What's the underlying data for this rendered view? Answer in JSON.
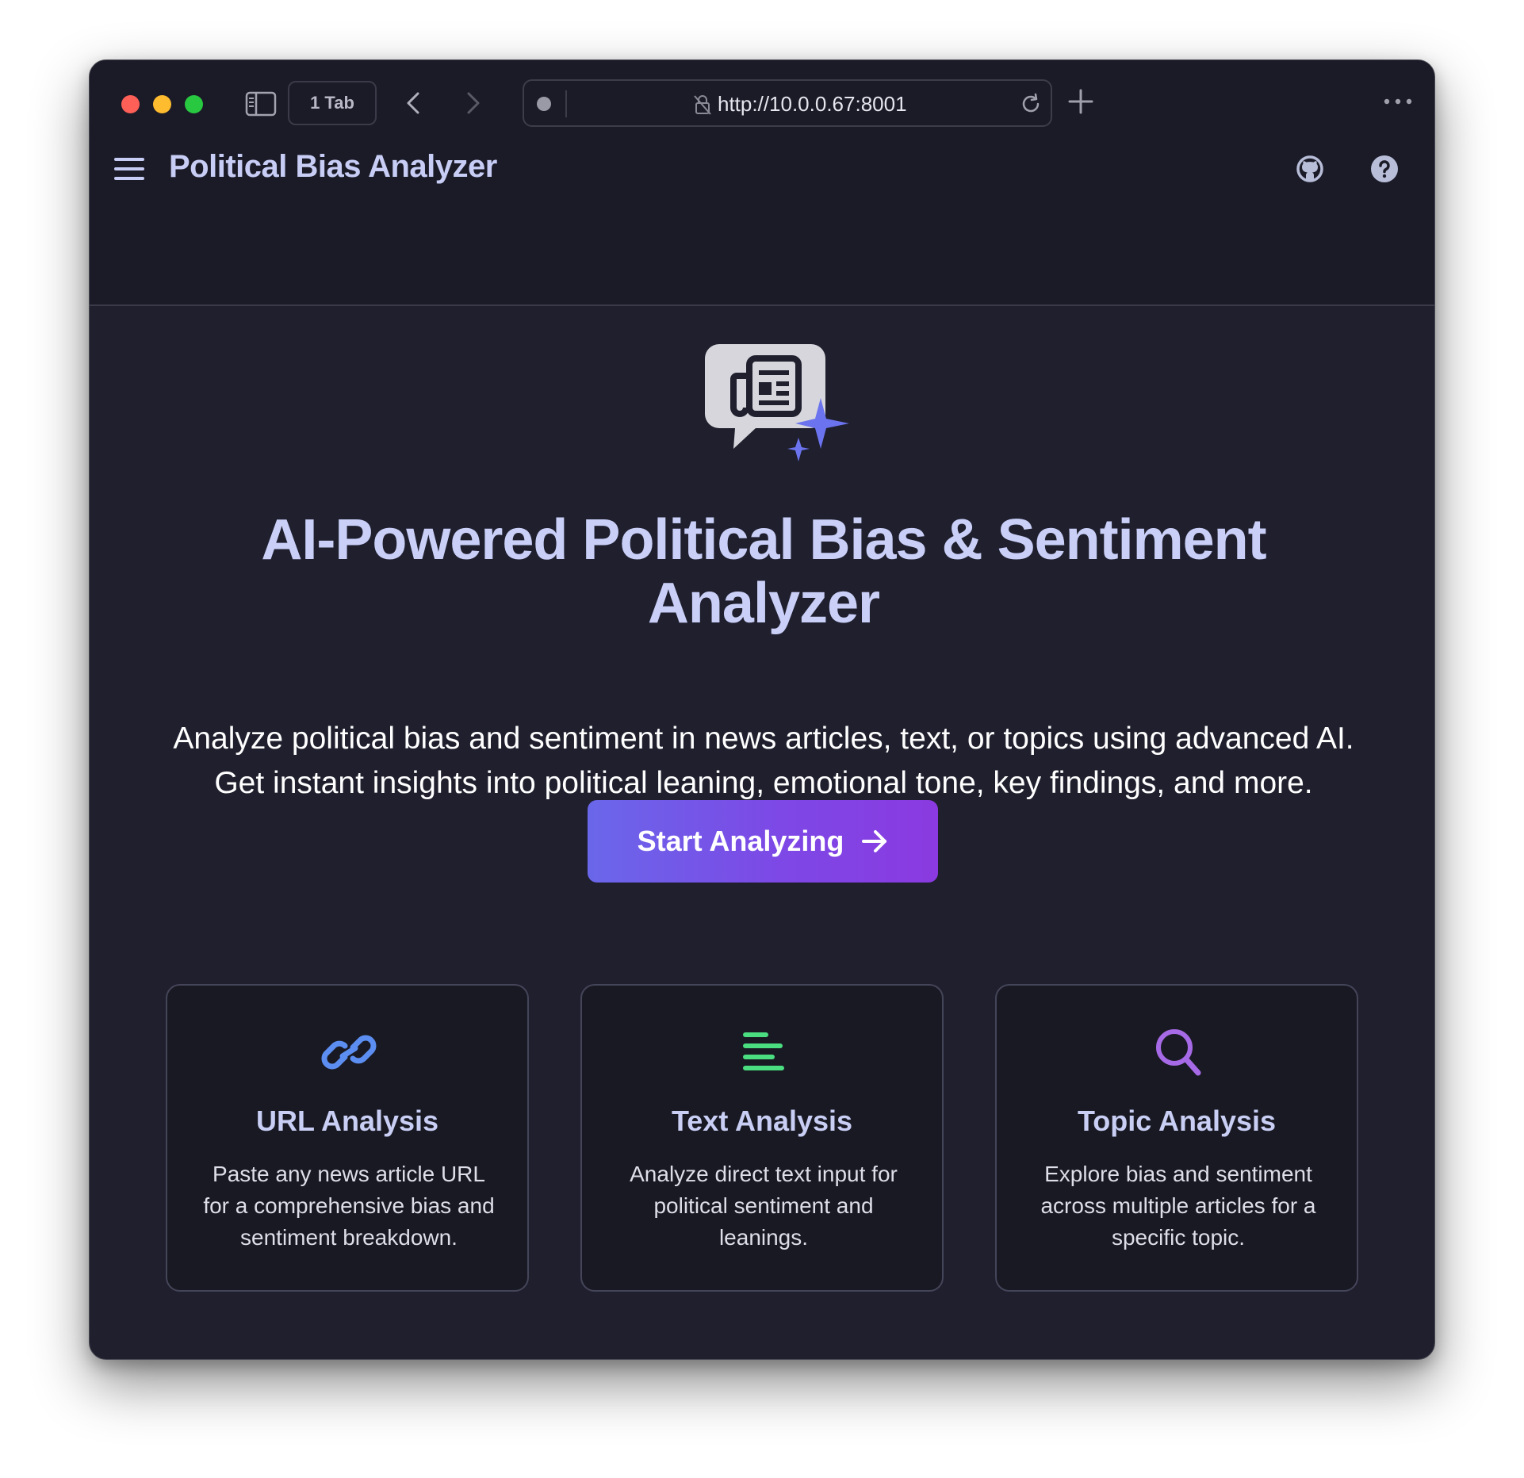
{
  "browser": {
    "tab_count_label": "1 Tab",
    "url": "http://10.0.0.67:8001"
  },
  "header": {
    "title": "Political Bias Analyzer"
  },
  "hero": {
    "title": "AI-Powered Political Bias & Sentiment Analyzer",
    "subtitle_line1": "Analyze political bias and sentiment in news articles, text, or topics using advanced AI.",
    "subtitle_line2": "Get instant insights into political leaning, emotional tone, key findings, and more.",
    "cta_label": "Start Analyzing"
  },
  "features": [
    {
      "title": "URL Analysis",
      "description": "Paste any news article URL for a comprehensive bias and sentiment breakdown.",
      "icon": "link-icon",
      "icon_color": "#5b8ef0"
    },
    {
      "title": "Text Analysis",
      "description": "Analyze direct text input for political sentiment and leanings.",
      "icon": "text-lines-icon",
      "icon_color": "#4ade80"
    },
    {
      "title": "Topic Analysis",
      "description": "Explore bias and sentiment across multiple articles for a specific topic.",
      "icon": "search-icon",
      "icon_color": "#a66ae6"
    }
  ],
  "colors": {
    "accent": "#6c63ff",
    "cta_gradient_start": "#6a67ea",
    "cta_gradient_end": "#8a3ae0",
    "title_text": "#c9cff7",
    "background": "#1f1f2e"
  }
}
